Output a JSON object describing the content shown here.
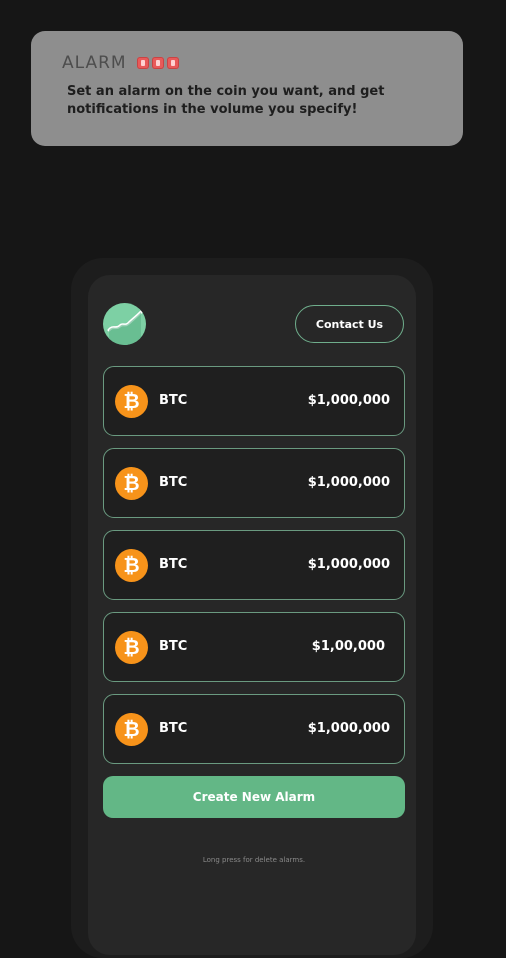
{
  "banner": {
    "title": "ALARM",
    "sirens": [
      "siren-icon",
      "siren-icon",
      "siren-icon"
    ],
    "description": "Set an alarm on the coin you want, and get notifications in the volume you specify!"
  },
  "header": {
    "logo_icon": "chart-trend-icon",
    "contact_label": "Contact Us"
  },
  "alarms": [
    {
      "symbol": "BTC",
      "price": "$1,000,000",
      "icon": "bitcoin-icon",
      "glyph": "₿"
    },
    {
      "symbol": "BTC",
      "price": "$1,000,000",
      "icon": "bitcoin-icon",
      "glyph": "₿"
    },
    {
      "symbol": "BTC",
      "price": "$1,000,000",
      "icon": "bitcoin-icon",
      "glyph": "₿"
    },
    {
      "symbol": "BTC",
      "price": "$1,00,000",
      "icon": "bitcoin-icon",
      "glyph": "₿"
    },
    {
      "symbol": "BTC",
      "price": "$1,000,000",
      "icon": "bitcoin-icon",
      "glyph": "₿"
    }
  ],
  "create_label": "Create New Alarm",
  "hint": "Long press for delete alarms.",
  "colors": {
    "accent": "#63b786",
    "bitcoin": "#f7931a",
    "background": "#161616",
    "card": "#272727"
  }
}
